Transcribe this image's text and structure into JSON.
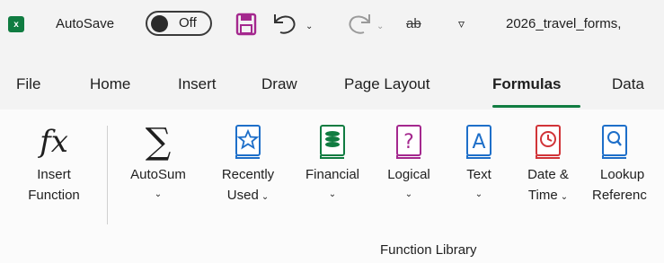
{
  "title_bar": {
    "app_icon": "excel-logo",
    "autosave_label": "AutoSave",
    "autosave_state": "Off",
    "strikethrough_label": "ab",
    "filename": "2026_travel_forms,",
    "icons": {
      "save": "save-icon",
      "undo": "undo-icon",
      "redo": "redo-icon",
      "customize": "customize-qat-icon"
    }
  },
  "tabs": [
    {
      "label": "File"
    },
    {
      "label": "Home"
    },
    {
      "label": "Insert"
    },
    {
      "label": "Draw"
    },
    {
      "label": "Page Layout"
    },
    {
      "label": "Formulas",
      "active": true
    },
    {
      "label": "Data"
    }
  ],
  "ribbon": {
    "insert_function": {
      "line1": "Insert",
      "line2": "Function",
      "icon": "fx-icon"
    },
    "autosum": {
      "label": "AutoSum",
      "icon": "sigma-icon"
    },
    "recently_used": {
      "line1": "Recently",
      "line2": "Used",
      "icon": "star-book-icon"
    },
    "financial": {
      "label": "Financial",
      "icon": "coins-book-icon"
    },
    "logical": {
      "label": "Logical",
      "icon": "question-book-icon"
    },
    "text": {
      "label": "Text",
      "icon": "a-book-icon"
    },
    "date_time": {
      "line1": "Date &",
      "line2": "Time",
      "icon": "clock-book-icon"
    },
    "lookup": {
      "line1": "Lookup",
      "line2": "Referenc",
      "icon": "magnifier-book-icon"
    },
    "group_label": "Function Library"
  },
  "colors": {
    "accent": "#107c41",
    "save_purple": "#a4288e",
    "book_blue": "#1e6fc9",
    "book_green": "#107c41",
    "book_purple": "#a4288e",
    "book_red": "#d13438"
  }
}
